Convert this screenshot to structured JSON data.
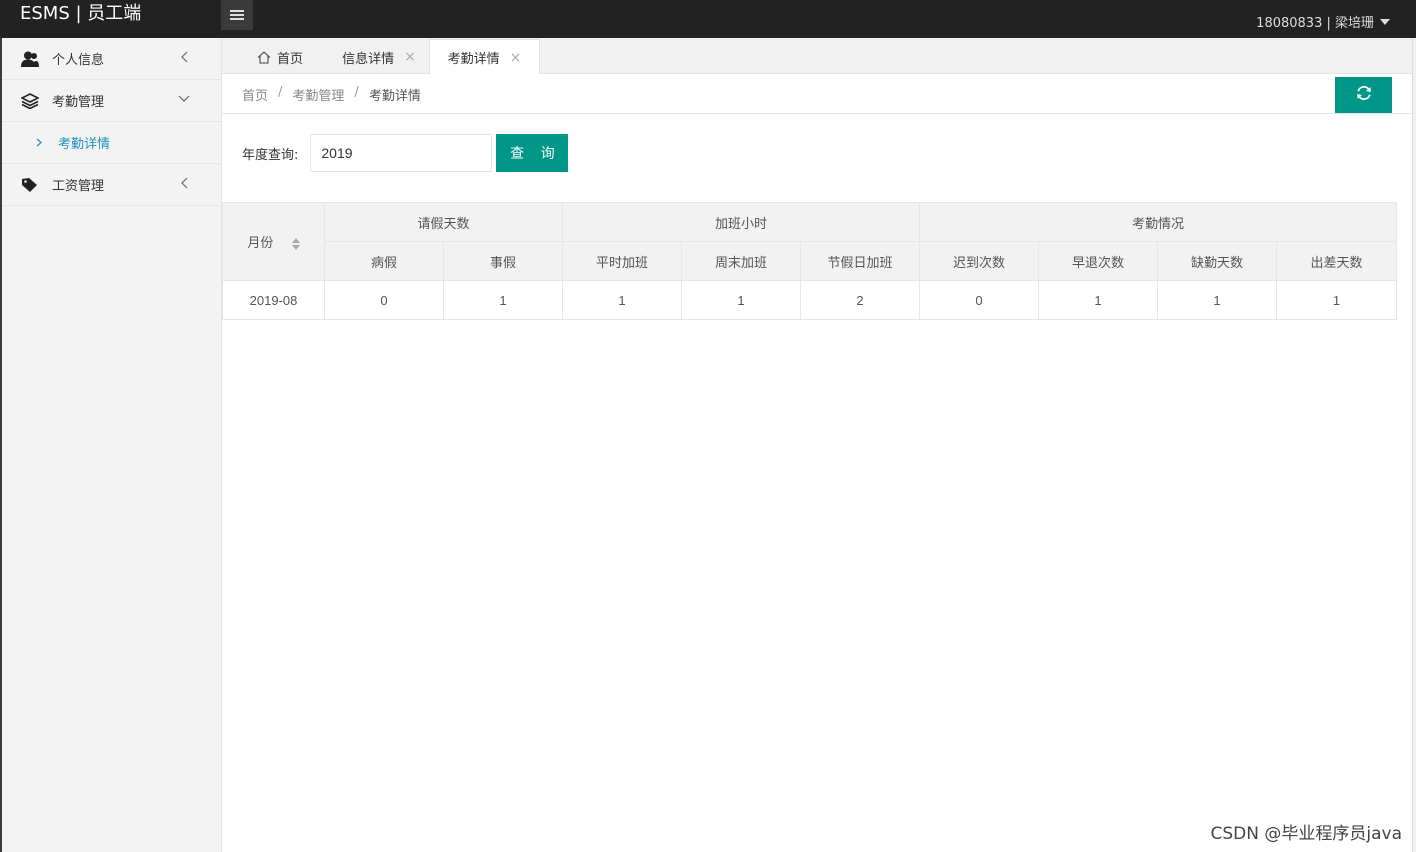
{
  "app": {
    "brand": "ESMS | 员工端"
  },
  "header": {
    "user": "18080833 | 梁培珊"
  },
  "sidebar": {
    "items": [
      {
        "label": "个人信息",
        "icon": "user-icon",
        "chevron": "chevron-left-icon"
      },
      {
        "label": "考勤管理",
        "icon": "layers-icon",
        "chevron": "chevron-down-icon"
      },
      {
        "label": "工资管理",
        "icon": "tag-icon",
        "chevron": "chevron-left-icon"
      }
    ],
    "subitems": [
      {
        "label": "考勤详情"
      }
    ]
  },
  "tabs": [
    {
      "label": "首页"
    },
    {
      "label": "信息详情"
    },
    {
      "label": "考勤详情"
    }
  ],
  "breadcrumb": {
    "items": [
      "首页",
      "考勤管理",
      "考勤详情"
    ],
    "sep": "/"
  },
  "filter": {
    "label": "年度查询:",
    "value": "2019",
    "button": "查 询"
  },
  "table": {
    "month_header": "月份",
    "groups": [
      "请假天数",
      "加班小时",
      "考勤情况"
    ],
    "columns": [
      "病假",
      "事假",
      "平时加班",
      "周末加班",
      "节假日加班",
      "迟到次数",
      "早退次数",
      "缺勤天数",
      "出差天数"
    ],
    "rows": [
      {
        "month": "2019-08",
        "values": [
          "0",
          "1",
          "1",
          "1",
          "2",
          "0",
          "1",
          "1",
          "1"
        ]
      }
    ]
  },
  "watermark": "CSDN @毕业程序员java",
  "colors": {
    "accent": "#009688",
    "topbar": "#222222",
    "link": "#1e8fc6"
  }
}
